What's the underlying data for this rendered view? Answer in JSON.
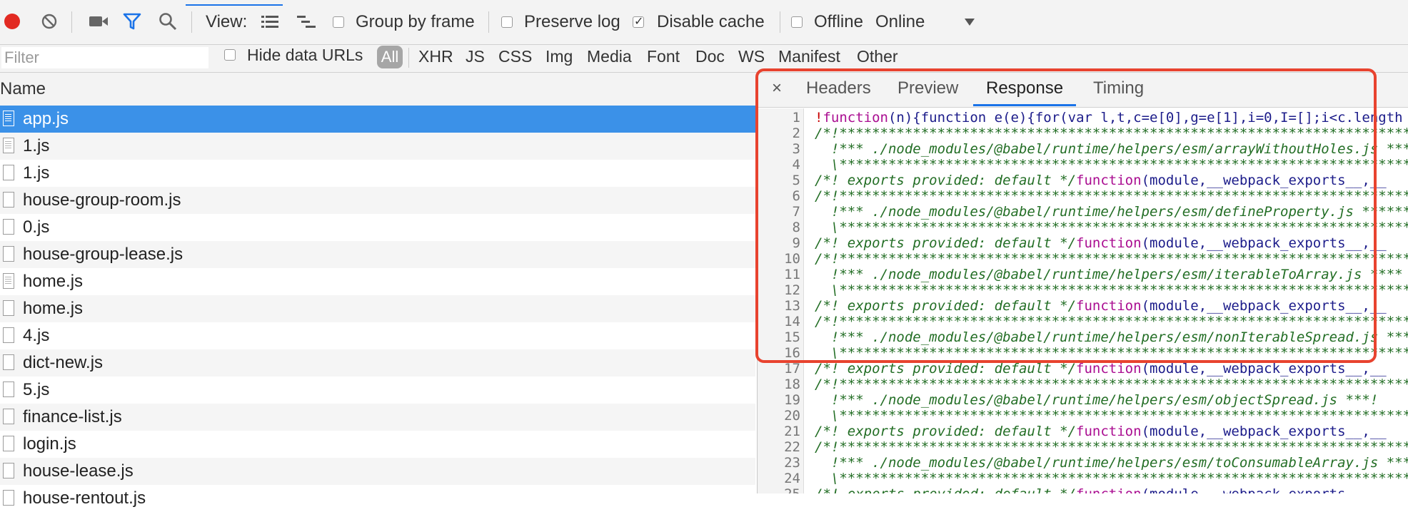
{
  "toolbar": {
    "view_label": "View:",
    "group_by_frame": "Group by frame",
    "preserve_log": "Preserve log",
    "disable_cache": "Disable cache",
    "offline": "Offline",
    "throttle": "Online",
    "disable_cache_checked": true
  },
  "filter_bar": {
    "filter_placeholder": "Filter",
    "hide_data_urls": "Hide data URLs",
    "types": [
      "All",
      "XHR",
      "JS",
      "CSS",
      "Img",
      "Media",
      "Font",
      "Doc",
      "WS",
      "Manifest",
      "Other"
    ]
  },
  "list": {
    "header": "Name",
    "files": [
      "app.js",
      "1.js",
      "1.js",
      "house-group-room.js",
      "0.js",
      "house-group-lease.js",
      "home.js",
      "home.js",
      "4.js",
      "dict-new.js",
      "5.js",
      "finance-list.js",
      "login.js",
      "house-lease.js",
      "house-rentout.js"
    ]
  },
  "panel": {
    "close": "×",
    "tabs": [
      "Headers",
      "Preview",
      "Response",
      "Timing"
    ],
    "active_tab": "Response",
    "code_lines": [
      {
        "n": "1",
        "kind": "code",
        "t": "!function(n){function e(e){for(var l,t,c=e[0],g=e[1],i=0,I=[];i<c.length"
      },
      {
        "n": "2",
        "kind": "comment",
        "t": "/*!**************************************************************************"
      },
      {
        "n": "3",
        "kind": "comment",
        "t": "  !*** ./node_modules/@babel/runtime/helpers/esm/arrayWithoutHoles.js ***!"
      },
      {
        "n": "4",
        "kind": "comment",
        "t": "  \\**************************************************************************"
      },
      {
        "n": "5",
        "kind": "export",
        "t": "/*! exports provided: default */function(module,__webpack_exports__,__"
      },
      {
        "n": "6",
        "kind": "comment",
        "t": "/*!**************************************************************************"
      },
      {
        "n": "7",
        "kind": "comment",
        "t": "  !*** ./node_modules/@babel/runtime/helpers/esm/defineProperty.js ******"
      },
      {
        "n": "8",
        "kind": "comment",
        "t": "  \\**************************************************************************"
      },
      {
        "n": "9",
        "kind": "export",
        "t": "/*! exports provided: default */function(module,__webpack_exports__,__"
      },
      {
        "n": "10",
        "kind": "comment",
        "t": "/*!**************************************************************************"
      },
      {
        "n": "11",
        "kind": "comment",
        "t": "  !*** ./node_modules/@babel/runtime/helpers/esm/iterableToArray.js ****"
      },
      {
        "n": "12",
        "kind": "comment",
        "t": "  \\**************************************************************************"
      },
      {
        "n": "13",
        "kind": "export",
        "t": "/*! exports provided: default */function(module,__webpack_exports__,__"
      },
      {
        "n": "14",
        "kind": "comment",
        "t": "/*!**************************************************************************"
      },
      {
        "n": "15",
        "kind": "comment",
        "t": "  !*** ./node_modules/@babel/runtime/helpers/esm/nonIterableSpread.js ***"
      },
      {
        "n": "16",
        "kind": "comment",
        "t": "  \\**************************************************************************"
      },
      {
        "n": "17",
        "kind": "export",
        "t": "/*! exports provided: default */function(module,__webpack_exports__,__"
      },
      {
        "n": "18",
        "kind": "comment",
        "t": "/*!**************************************************************************!*"
      },
      {
        "n": "19",
        "kind": "comment",
        "t": "  !*** ./node_modules/@babel/runtime/helpers/esm/objectSpread.js ***!"
      },
      {
        "n": "20",
        "kind": "comment",
        "t": "  \\**************************************************************************/"
      },
      {
        "n": "21",
        "kind": "export",
        "t": "/*! exports provided: default */function(module,__webpack_exports__,__"
      },
      {
        "n": "22",
        "kind": "comment",
        "t": "/*!**************************************************************************"
      },
      {
        "n": "23",
        "kind": "comment",
        "t": "  !*** ./node_modules/@babel/runtime/helpers/esm/toConsumableArray.js ***"
      },
      {
        "n": "24",
        "kind": "comment",
        "t": "  \\**************************************************************************"
      },
      {
        "n": "25",
        "kind": "export",
        "t": "/*! exports provided: default */function(module,__webpack_exports__,__"
      }
    ]
  },
  "colors": {
    "record": "#e22a22",
    "accent": "#1a73e8",
    "selected_row": "#3b91e8",
    "highlight_box": "#e8432f"
  },
  "icons": {
    "record": "record-icon",
    "clear": "clear-icon",
    "camera": "camera-icon",
    "filter": "filter-icon",
    "search": "search-icon",
    "large_rows": "list-view-icon",
    "waterfall": "waterfall-view-icon",
    "dropdown": "chevron-down-icon"
  }
}
